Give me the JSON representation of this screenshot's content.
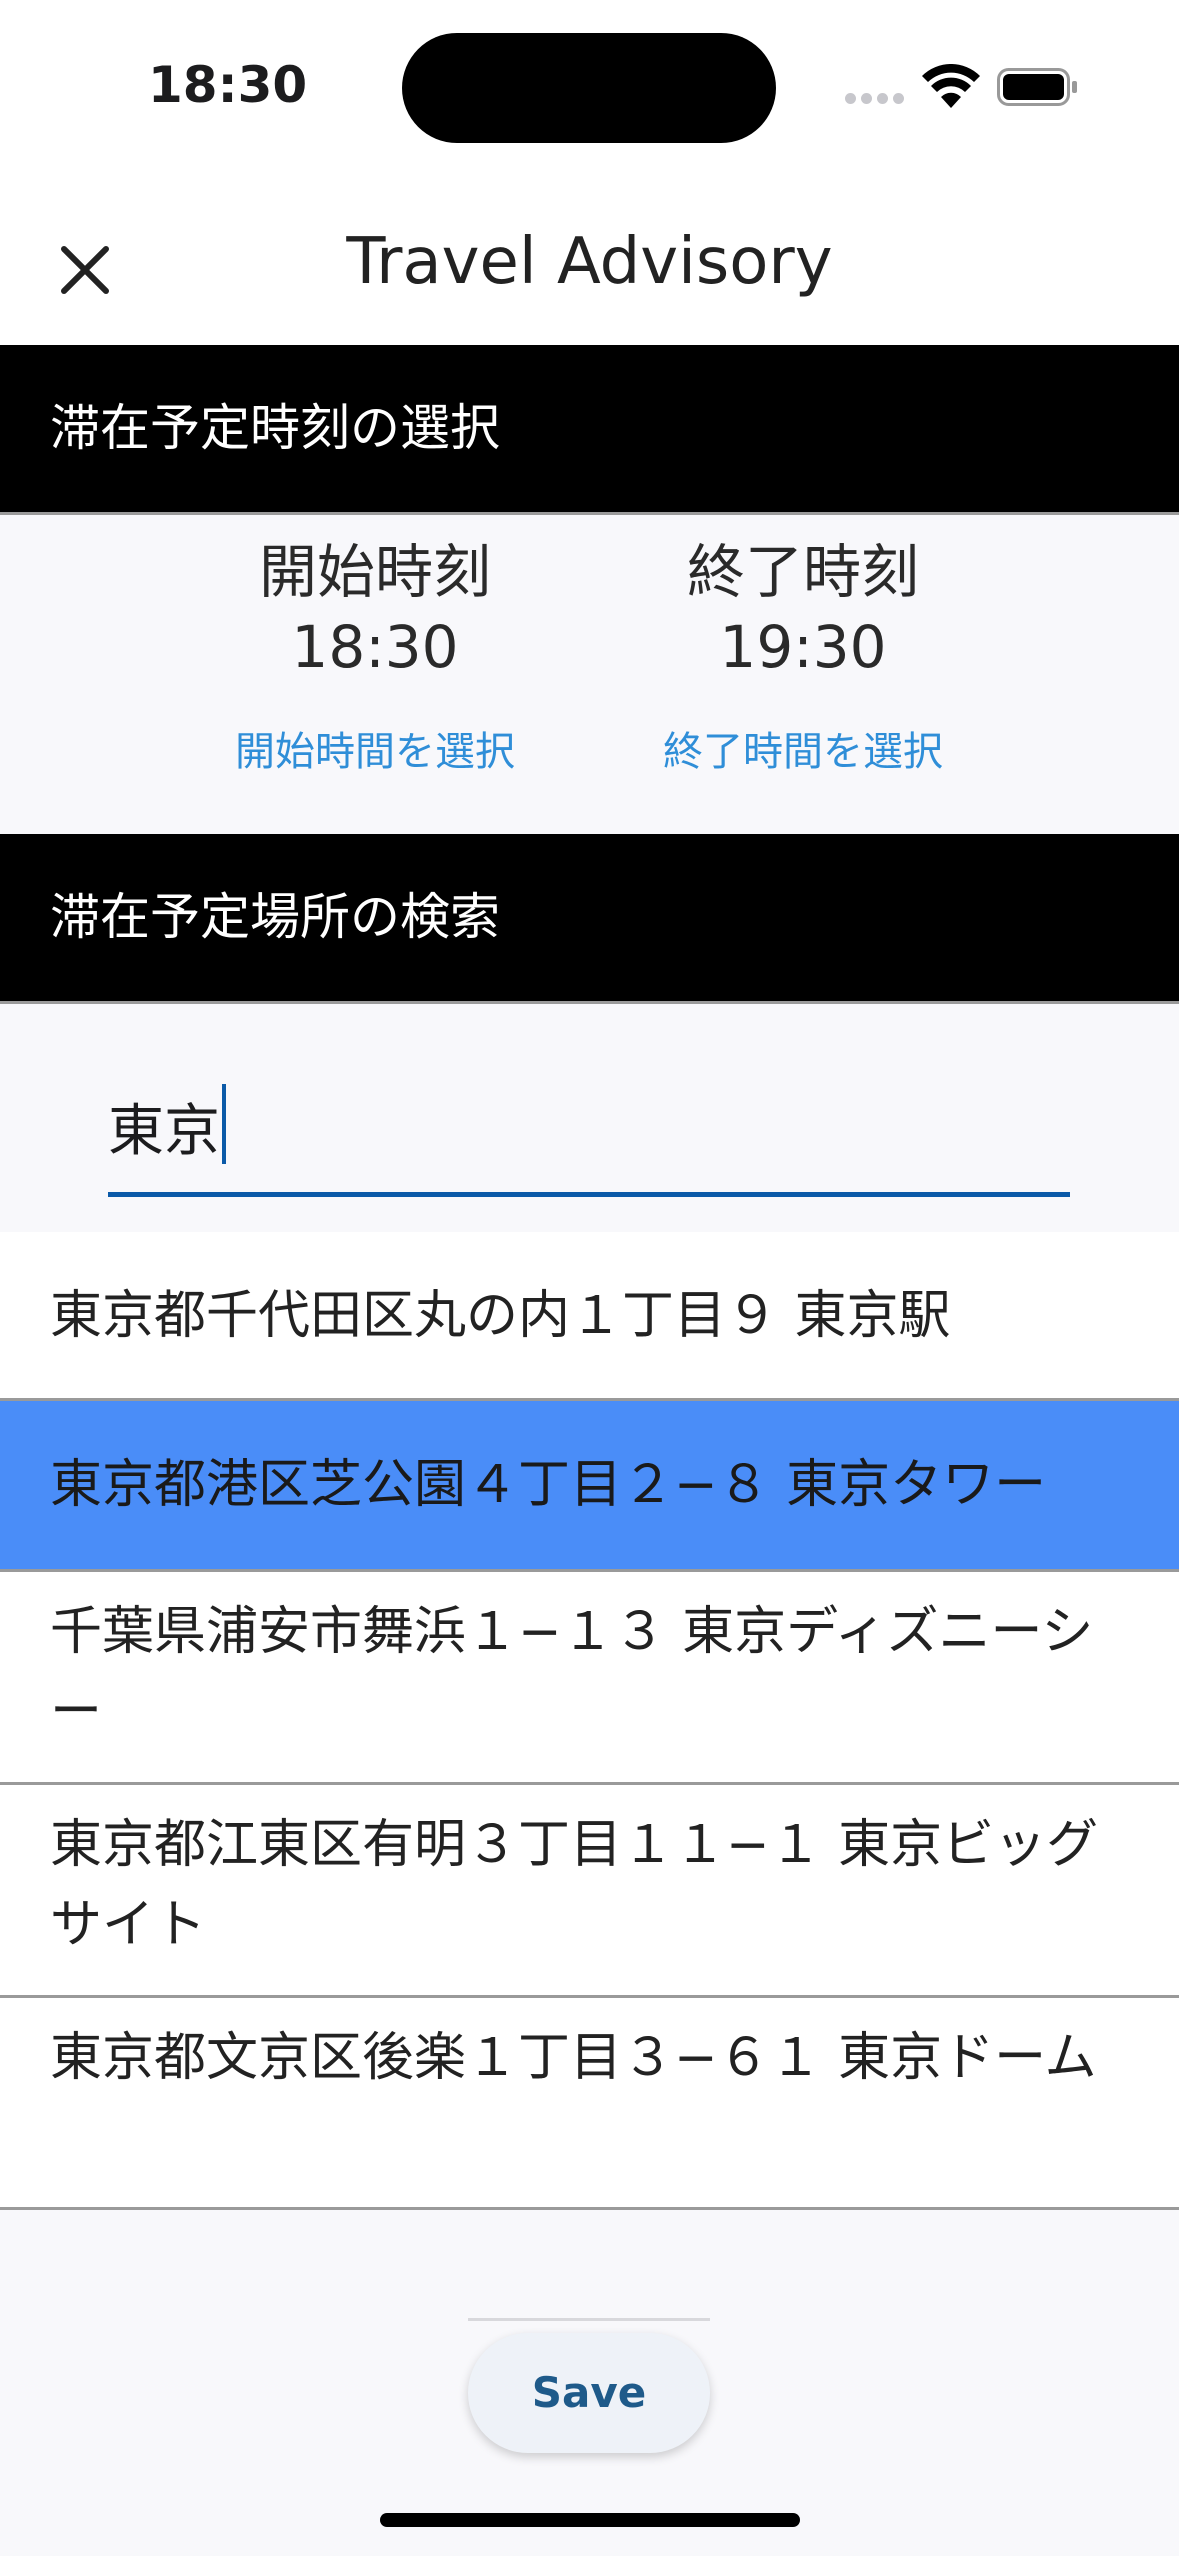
{
  "status_bar": {
    "time": "18:30"
  },
  "header": {
    "title": "Travel Advisory"
  },
  "time_section": {
    "heading": "滞在予定時刻の選択",
    "start": {
      "label": "開始時刻",
      "value": "18:30",
      "link": "開始時間を選択"
    },
    "end": {
      "label": "終了時刻",
      "value": "19:30",
      "link": "終了時間を選択"
    }
  },
  "place_section": {
    "heading": "滞在予定場所の検索",
    "search_value": "東京",
    "results": [
      {
        "text": "東京都千代田区丸の内１丁目９ 東京駅"
      },
      {
        "text": "東京都港区芝公園４丁目２−８ 東京タワー"
      },
      {
        "text": "千葉県浦安市舞浜１−１３ 東京ディズニーシー"
      },
      {
        "text": "東京都江東区有明３丁目１１−１ 東京ビッグサイト"
      },
      {
        "text": "東京都文京区後楽１丁目３−６１ 東京ドーム"
      }
    ]
  },
  "footer": {
    "save_label": "Save"
  },
  "colors": {
    "accent": "#0b5aa8",
    "link": "#2f8ed8",
    "selected_row": "#4a8df8",
    "header_bg": "#000000"
  }
}
